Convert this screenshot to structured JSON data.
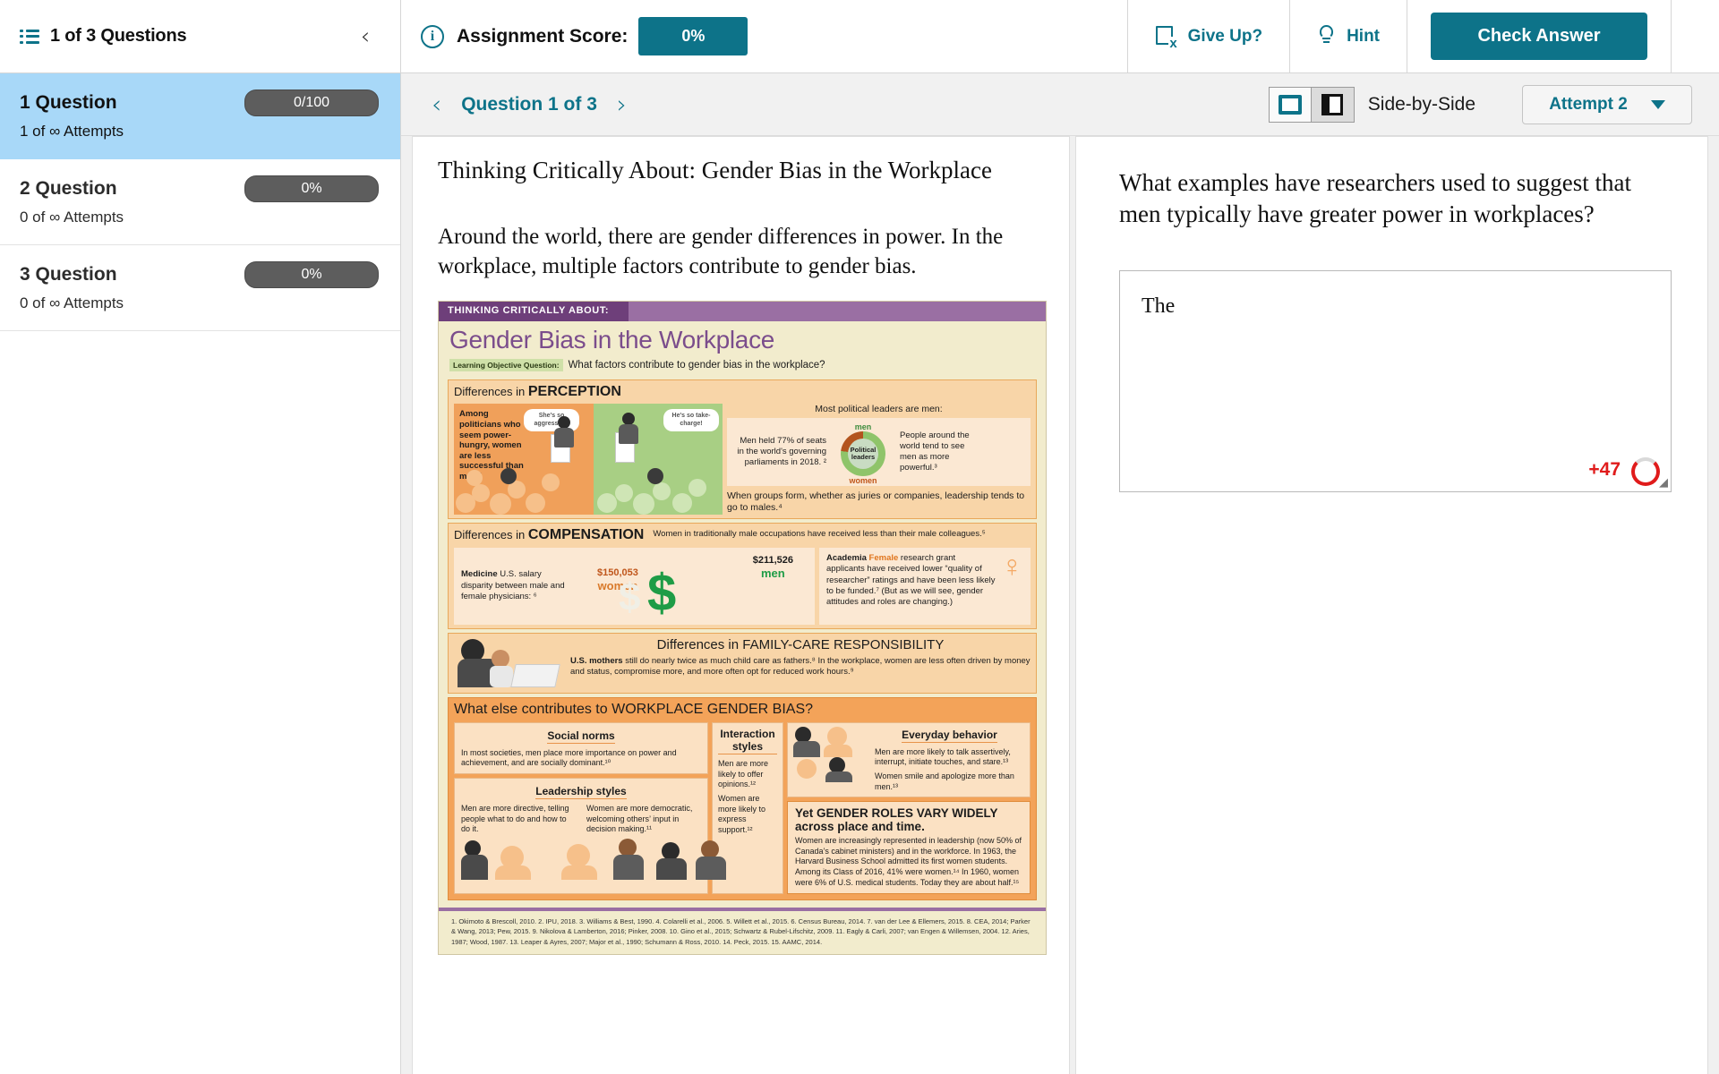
{
  "topbar": {
    "menu_icon": "list-icon",
    "questions_count_label": "1 of 3 Questions",
    "collapse_icon": "chevron-left-icon",
    "info_icon": "info-icon",
    "assignment_score_label": "Assignment Score:",
    "assignment_score_value": "0%",
    "give_up_label": "Give Up?",
    "give_up_icon": "give-up-icon",
    "hint_label": "Hint",
    "hint_icon": "lightbulb-icon",
    "check_answer_label": "Check Answer",
    "accent_color": "#0d7389"
  },
  "sidebar": {
    "items": [
      {
        "title": "1 Question",
        "badge": "0/100",
        "attempts": "1 of ∞ Attempts",
        "active": true
      },
      {
        "title": "2 Question",
        "badge": "0%",
        "attempts": "0 of ∞ Attempts",
        "active": false
      },
      {
        "title": "3 Question",
        "badge": "0%",
        "attempts": "0 of ∞ Attempts",
        "active": false
      }
    ],
    "active_bg": "#a8d8f8"
  },
  "subbar": {
    "prev_icon": "chevron-left-icon",
    "next_icon": "chevron-right-icon",
    "question_counter": "Question 1 of 3",
    "view_stacked_icon": "stacked-view-icon",
    "view_sidebyside_icon": "side-by-side-view-icon",
    "view_label": "Side-by-Side",
    "attempt_label": "Attempt 2",
    "attempt_caret_icon": "chevron-down-icon"
  },
  "reading": {
    "title": "Thinking Critically About: Gender Bias in the Workplace",
    "paragraph": "Around the world, there are gender differences in power. In the workplace, multiple factors contribute to gender bias."
  },
  "question": {
    "prompt": "What examples have researchers used to suggest that men typically have greater power in workplaces?",
    "answer_text": "The",
    "char_count": "+47",
    "char_count_color": "#e01b1b",
    "resize_icon": "resize-grip-icon"
  },
  "infographic": {
    "eyebrow": "THINKING CRITICALLY ABOUT:",
    "title": "Gender Bias in the Workplace",
    "loq_tag": "Learning Objective Question:",
    "loq_text": "What factors contribute to gender bias in the workplace?",
    "perception": {
      "heading_small": "Differences in",
      "heading_big": "PERCEPTION",
      "caption": "Among politicians who seem power-hungry, women are less successful than men.¹",
      "bubble_women": "She's so aggressive!",
      "bubble_men": "He's so take-charge!",
      "lead": "Most political leaders are men:",
      "stat_left": "Men held 77% of seats in the world's governing parliaments in 2018. ²",
      "donut_label": "Political leaders",
      "donut_men": "men",
      "donut_women": "women",
      "stat_right": "People around the world tend to see men as more powerful.³",
      "note": "When groups form, whether as juries or companies, leadership tends to go to males.⁴"
    },
    "compensation": {
      "heading_small": "Differences in",
      "heading_big": "COMPENSATION",
      "note": "Women in traditionally male occupations have received less than their male colleagues.⁵",
      "medicine_label": "Medicine",
      "medicine_text": "U.S. salary disparity between male and female physicians: ⁶",
      "women_salary": "$150,053",
      "women_label": "women",
      "men_salary": "$211,526",
      "men_label": "men",
      "academia_label": "Academia",
      "academia_female": "Female",
      "academia_text": "research grant applicants have received lower “quality of researcher” ratings and have been less likely to be funded.⁷ (But as we will see, gender attitudes and roles are changing.)"
    },
    "family": {
      "heading_small": "Differences in",
      "heading_big": "FAMILY-CARE RESPONSIBILITY",
      "text_lead": "U.S. mothers",
      "text": "still do nearly twice as much child care as fathers.⁸ In the workplace, women are less often driven by money and status, compromise more, and more often opt for reduced work hours.⁹"
    },
    "workplace": {
      "heading_small": "What else contributes to",
      "heading_big": "WORKPLACE GENDER BIAS?",
      "social_norms_title": "Social norms",
      "social_norms_text": "In most societies, men place more importance on power and achievement, and are socially dominant.¹⁰",
      "leadership_title": "Leadership styles",
      "leadership_men": "Men are more directive, telling people what to do and how to do it.",
      "leadership_women": "Women are more democratic, welcoming others’ input in decision making.¹¹",
      "interaction_title": "Interaction styles",
      "interaction_men": "Men are more likely to offer opinions.¹²",
      "interaction_women": "Women are more likely to express support.¹²",
      "everyday_title": "Everyday behavior",
      "everyday_men": "Men are more likely to talk assertively, interrupt, initiate touches, and stare.¹³",
      "everyday_women": "Women smile and apologize more than men.¹³",
      "vary_title": "Yet GENDER ROLES VARY WIDELY across place and time.",
      "vary_text": "Women are increasingly represented in leadership (now 50% of Canada’s cabinet ministers) and in the workforce. In 1963, the Harvard Business School admitted its first women students. Among its Class of 2016, 41% were women.¹⁴ In 1960, women were 6% of U.S. medical students. Today they are about half.¹⁵"
    },
    "references": "1. Okimoto & Brescoll, 2010.   2. IPU, 2018.   3. Williams & Best, 1990.   4. Colarelli et al., 2006.   5.  Willett et al., 2015.   6. Census Bureau, 2014.   7. van der Lee & Ellemers, 2015.   8. CEA, 2014; Parker & Wang, 2013; Pew, 2015.   9. Nikolova & Lamberton, 2016; Pinker, 2008.   10. Gino et al., 2015; Schwartz & Rubel-Lifschitz, 2009.   11. Eagly & Carli, 2007; van Engen & Willemsen, 2004.   12.  Aries, 1987; Wood, 1987.   13. Leaper & Ayres, 2007; Major et al., 1990; Schumann & Ross, 2010.   14. Peck, 2015. 15. AAMC, 2014."
  }
}
